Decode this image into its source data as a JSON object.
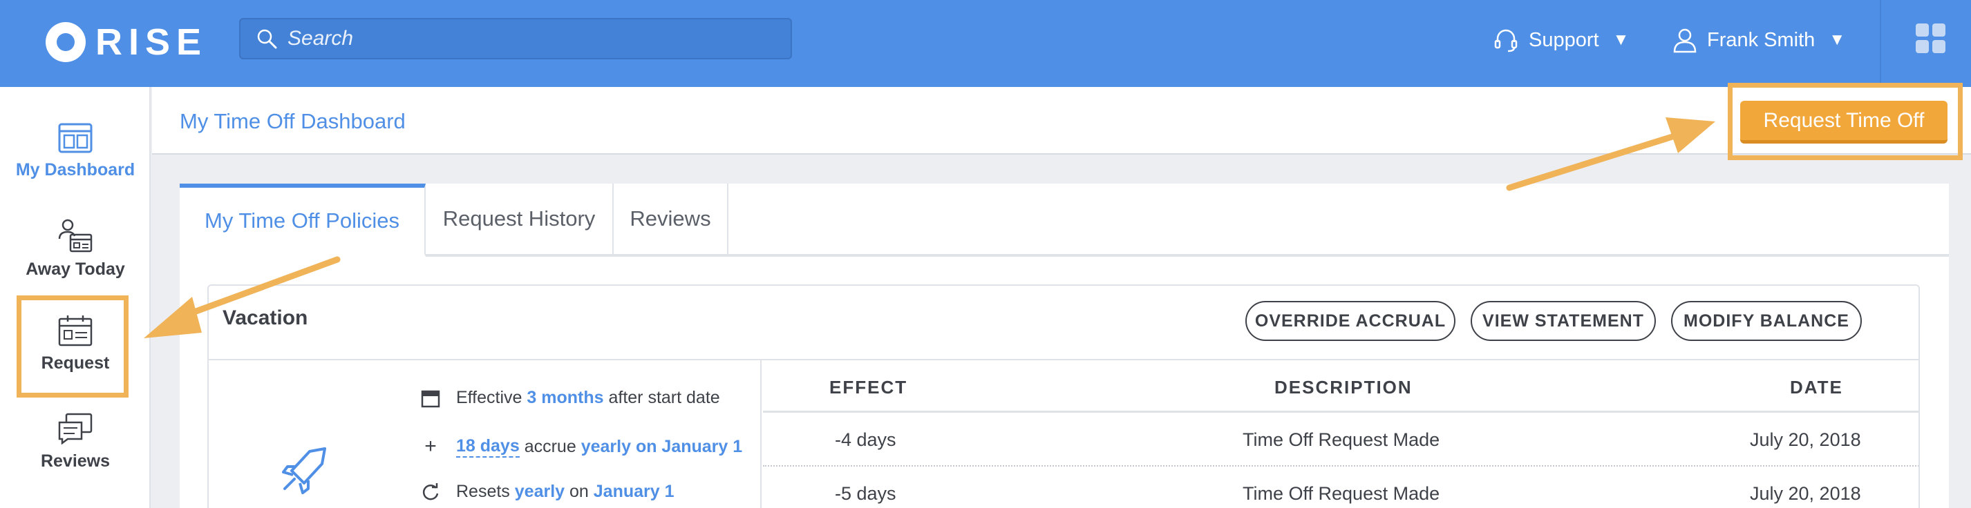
{
  "app": {
    "brand": "RISE"
  },
  "search": {
    "placeholder": "Search"
  },
  "topbar": {
    "support_label": "Support",
    "user_label": "Frank Smith"
  },
  "sidebar": {
    "items": [
      {
        "label": "My Dashboard",
        "icon": "dashboard-icon"
      },
      {
        "label": "Away Today",
        "icon": "away-icon"
      },
      {
        "label": "Request",
        "icon": "request-icon"
      },
      {
        "label": "Reviews",
        "icon": "reviews-icon"
      }
    ]
  },
  "header": {
    "title": "My Time Off Dashboard",
    "request_button": "Request Time Off"
  },
  "tabs": [
    {
      "label": "My Time Off Policies"
    },
    {
      "label": "Request History"
    },
    {
      "label": "Reviews"
    }
  ],
  "policy": {
    "title": "Vacation",
    "actions": [
      "OVERRIDE ACCRUAL",
      "VIEW STATEMENT",
      "MODIFY BALANCE"
    ],
    "info": {
      "effective_pre": "Effective",
      "effective_val": "3 months",
      "effective_post": "after start date",
      "accrue_days": "18 days",
      "accrue_mid": "accrue",
      "accrue_when": "yearly on January 1",
      "resets_pre": "Resets",
      "resets_val": "yearly",
      "resets_mid": "on",
      "resets_date": "January 1"
    },
    "columns": [
      "EFFECT",
      "DESCRIPTION",
      "DATE"
    ],
    "rows": [
      {
        "effect": "-4 days",
        "description": "Time Off Request Made",
        "date": "July 20, 2018"
      },
      {
        "effect": "-5 days",
        "description": "Time Off Request Made",
        "date": "July 20, 2018"
      }
    ]
  },
  "colors": {
    "primary": "#4f8fe6",
    "accent": "#f2a73b",
    "highlight": "#f0b357"
  }
}
